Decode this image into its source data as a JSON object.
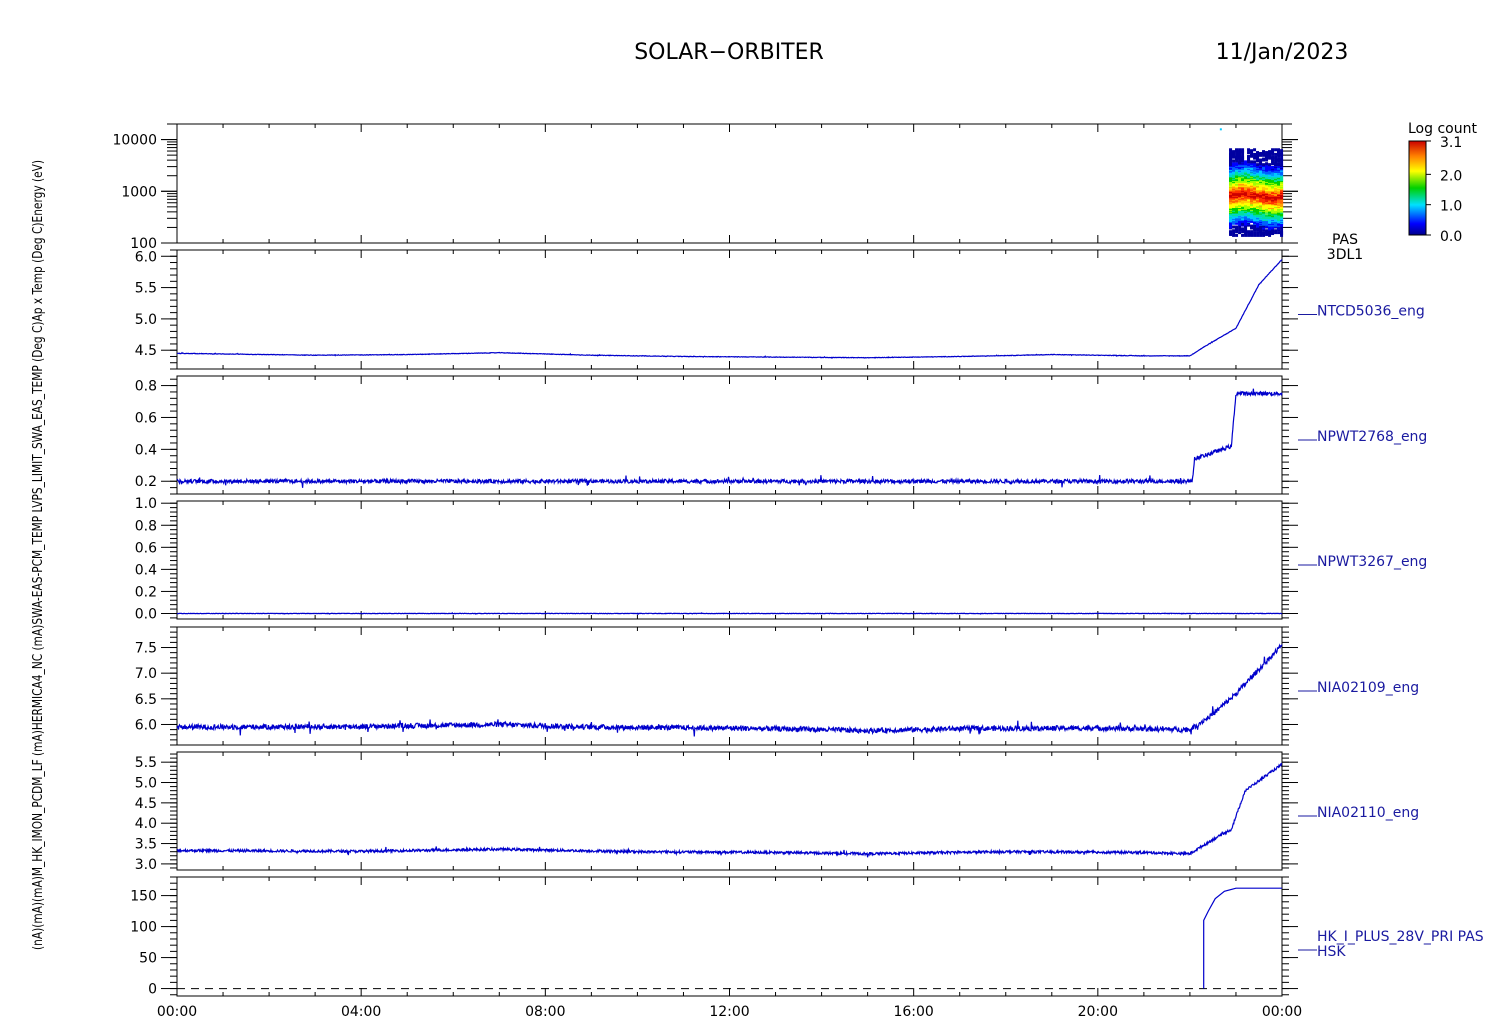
{
  "header": {
    "title": "SOLAR−ORBITER",
    "date": "11/Jan/2023"
  },
  "colorbar": {
    "label": "Log count",
    "ticks": [
      "3.1",
      "2.0",
      "1.0",
      "0.0"
    ]
  },
  "ylabel_stack": "(nA)(mA)(mA)M_HK_IMON_PCDM_LF (mA)HERMICA4_NC (mA)SWA-EAS-PCM_TEMP LVPS_LIMIT_SWA_EAS_TEMP (Deg C)Ap x Temp (Deg C)Energy (eV)",
  "chart_data": [
    {
      "type": "heatmap",
      "name": "spectrogram",
      "ylabel": "Energy (eV)",
      "ylog": true,
      "ylim": [
        100,
        20000
      ],
      "yticks": [
        {
          "value": 100,
          "label": "100"
        },
        {
          "value": 1000,
          "label": "1000"
        },
        {
          "value": 10000,
          "label": "10000"
        }
      ],
      "data_span_hours": [
        22.85,
        24.0
      ],
      "peak_energy_eV": 900,
      "colorscale_max": 3.1,
      "right_label": [
        "PAS",
        "3DL1"
      ]
    },
    {
      "type": "line",
      "name": "temp1",
      "right_label": "NTCD5036_eng",
      "ylim": [
        4.2,
        6.1
      ],
      "yticks": [
        {
          "value": 4.5,
          "label": "4.5"
        },
        {
          "value": 5.0,
          "label": "5.0"
        },
        {
          "value": 5.5,
          "label": "5.5"
        },
        {
          "value": 6.0,
          "label": "6.0"
        }
      ],
      "noise": 0.004,
      "x": [
        0,
        1,
        3,
        5,
        7,
        9,
        11,
        13,
        15,
        17,
        19,
        21,
        22,
        22.3,
        23,
        23.5,
        24
      ],
      "y": [
        4.45,
        4.44,
        4.42,
        4.43,
        4.46,
        4.42,
        4.4,
        4.39,
        4.38,
        4.4,
        4.43,
        4.41,
        4.41,
        4.55,
        4.85,
        5.55,
        5.95
      ]
    },
    {
      "type": "line",
      "name": "current1",
      "right_label": "NPWT2768_eng",
      "ylim": [
        0.12,
        0.86
      ],
      "yticks": [
        {
          "value": 0.2,
          "label": "0.2"
        },
        {
          "value": 0.4,
          "label": "0.4"
        },
        {
          "value": 0.6,
          "label": "0.6"
        },
        {
          "value": 0.8,
          "label": "0.8"
        }
      ],
      "noise": 0.012,
      "x": [
        0,
        22.05,
        22.1,
        22.7,
        22.9,
        23.0,
        24
      ],
      "y": [
        0.2,
        0.2,
        0.34,
        0.4,
        0.42,
        0.75,
        0.75
      ]
    },
    {
      "type": "line",
      "name": "current2",
      "right_label": "NPWT3267_eng",
      "ylim": [
        -0.05,
        1.02
      ],
      "yticks": [
        {
          "value": 0.0,
          "label": "0.0"
        },
        {
          "value": 0.2,
          "label": "0.2"
        },
        {
          "value": 0.4,
          "label": "0.4"
        },
        {
          "value": 0.6,
          "label": "0.6"
        },
        {
          "value": 0.8,
          "label": "0.8"
        },
        {
          "value": 1.0,
          "label": "1.0"
        }
      ],
      "noise": 0.002,
      "x": [
        0,
        24
      ],
      "y": [
        0.0,
        0.0
      ]
    },
    {
      "type": "line",
      "name": "current3",
      "right_label": "NIA02109_eng",
      "ylim": [
        5.6,
        7.9
      ],
      "yticks": [
        {
          "value": 6.0,
          "label": "6.0"
        },
        {
          "value": 6.5,
          "label": "6.5"
        },
        {
          "value": 7.0,
          "label": "7.0"
        },
        {
          "value": 7.5,
          "label": "7.5"
        }
      ],
      "noise": 0.05,
      "x": [
        0,
        4,
        7,
        9,
        12,
        14,
        15,
        17,
        20,
        22,
        22.5,
        23,
        24
      ],
      "y": [
        5.95,
        5.96,
        6.0,
        5.95,
        5.93,
        5.9,
        5.88,
        5.92,
        5.93,
        5.9,
        6.2,
        6.6,
        7.55
      ]
    },
    {
      "type": "line",
      "name": "current4",
      "right_label": "NIA02110_eng",
      "ylim": [
        2.85,
        5.75
      ],
      "yticks": [
        {
          "value": 3.0,
          "label": "3.0"
        },
        {
          "value": 3.5,
          "label": "3.5"
        },
        {
          "value": 4.0,
          "label": "4.0"
        },
        {
          "value": 4.5,
          "label": "4.5"
        },
        {
          "value": 5.0,
          "label": "5.0"
        },
        {
          "value": 5.5,
          "label": "5.5"
        }
      ],
      "noise": 0.03,
      "x": [
        0,
        4,
        7,
        10,
        13,
        15,
        18,
        21,
        22,
        22.5,
        22.9,
        23.2,
        24
      ],
      "y": [
        3.33,
        3.31,
        3.36,
        3.3,
        3.28,
        3.25,
        3.3,
        3.28,
        3.25,
        3.6,
        3.85,
        4.8,
        5.45
      ]
    },
    {
      "type": "line",
      "name": "hk_current",
      "right_label": [
        "HK_I_PLUS_28V_PRI PAS",
        "HSK"
      ],
      "ylim": [
        -12,
        180
      ],
      "yticks": [
        {
          "value": 0,
          "label": "0"
        },
        {
          "value": 50,
          "label": "50"
        },
        {
          "value": 100,
          "label": "100"
        },
        {
          "value": 150,
          "label": "150"
        }
      ],
      "noise": 0,
      "dashed_zero": true,
      "x": [
        22.3,
        22.3,
        22.4,
        22.55,
        22.75,
        23.0,
        24
      ],
      "y": [
        0,
        110,
        125,
        145,
        157,
        162,
        162
      ]
    }
  ],
  "x_axis": {
    "range_hours": [
      0,
      24
    ],
    "ticks": [
      {
        "value": 0,
        "label": "00:00"
      },
      {
        "value": 4,
        "label": "04:00"
      },
      {
        "value": 8,
        "label": "08:00"
      },
      {
        "value": 12,
        "label": "12:00"
      },
      {
        "value": 16,
        "label": "16:00"
      },
      {
        "value": 20,
        "label": "20:00"
      },
      {
        "value": 24,
        "label": "00:00"
      }
    ]
  },
  "colors": {
    "trace": "#0000cc",
    "label": "#1a1aa0"
  }
}
